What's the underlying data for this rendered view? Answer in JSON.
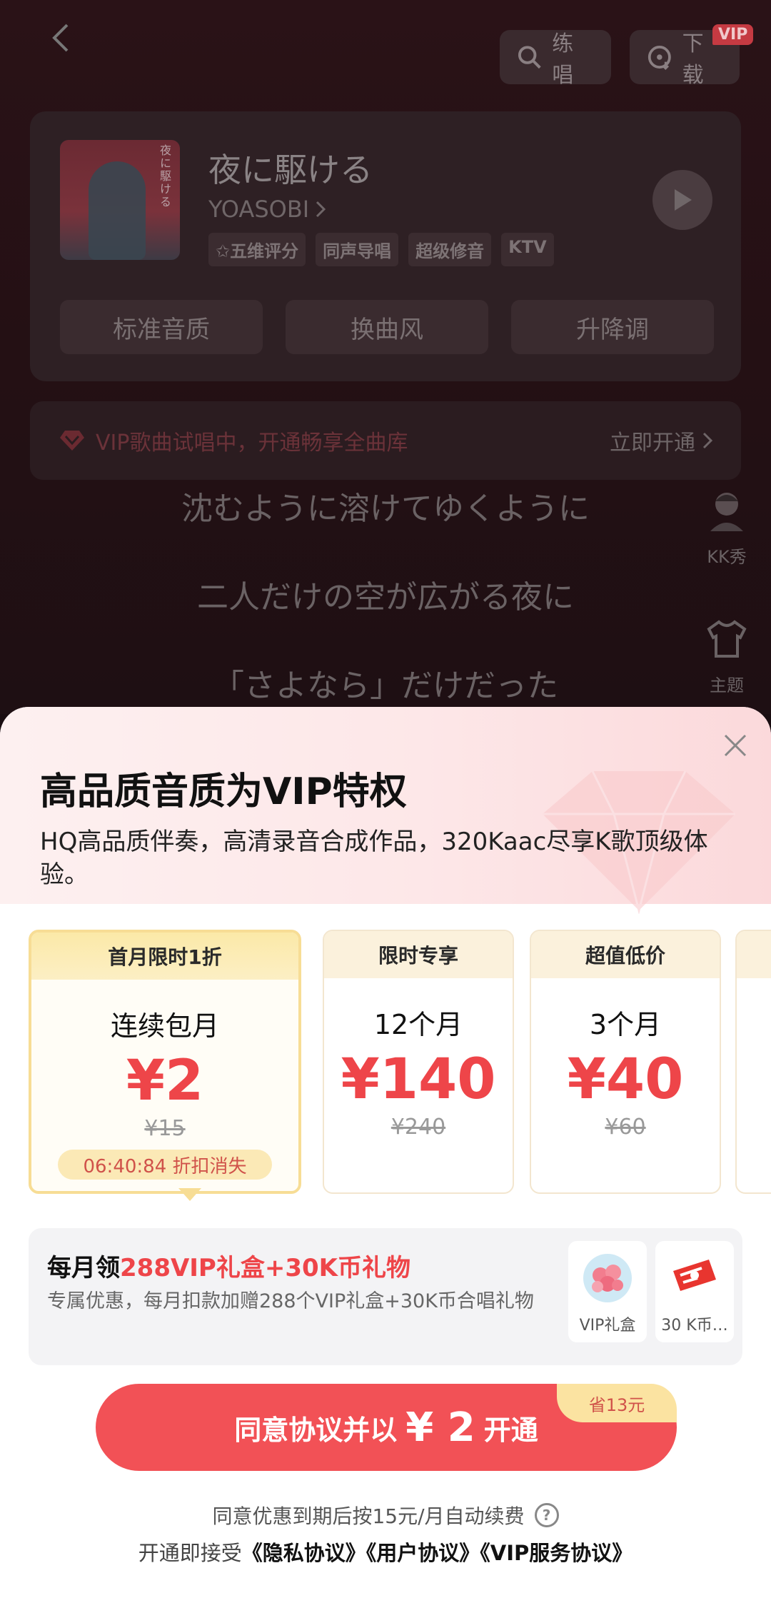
{
  "player": {
    "practice_label": "练唱",
    "download_label": "下载",
    "download_badge": "VIP",
    "song_title": "夜に駆ける",
    "artist": "YOASOBI",
    "cover_text": "夜に駆ける",
    "tags": [
      "五维评分",
      "同声导唱",
      "超级修音",
      "KTV"
    ],
    "options": [
      "标准音质",
      "换曲风",
      "升降调"
    ],
    "vip_banner_text": "VIP歌曲试唱中，开通畅享全曲库",
    "vip_banner_link": "立即开通",
    "lyrics": [
      "沈むように溶けてゆくように",
      "二人だけの空が広がる夜に",
      "「さよなら」だけだった"
    ],
    "side_kk": "KK秀",
    "side_theme": "主题"
  },
  "sheet": {
    "title": "高品质音质为VIP特权",
    "description": "HQ高品质伴奏，高清录音合成作品，320Kaac尽享K歌顶级体验。",
    "plans": [
      {
        "tag": "首月限时1折",
        "name": "连续包月",
        "price": "¥2",
        "original": "¥15",
        "countdown": "06:40:84 折扣消失"
      },
      {
        "tag": "限时专享",
        "name": "12个月",
        "price": "¥140",
        "original": "¥240"
      },
      {
        "tag": "超值低价",
        "name": "3个月",
        "price": "¥40",
        "original": "¥60"
      }
    ],
    "benefit": {
      "title_prefix": "每月领",
      "title_highlight": "288VIP礼盒+30K币礼物",
      "description": "专属优惠，每月扣款加赠288个VIP礼盒+30K币合唱礼物",
      "gifts": [
        "VIP礼盒",
        "30 K币…"
      ]
    },
    "cta": {
      "prefix": "同意协议并以",
      "amount": "¥ 2",
      "suffix": "开通",
      "save_badge": "省13元"
    },
    "renew_note": "同意优惠到期后按15元/月自动续费",
    "agreement_prefix": "开通即接受",
    "agreements": [
      "《隐私协议》",
      "《用户协议》",
      "《VIP服务协议》"
    ]
  },
  "colors": {
    "accent": "#f25156",
    "price": "#ee4549",
    "gold": "#f7dd95"
  }
}
